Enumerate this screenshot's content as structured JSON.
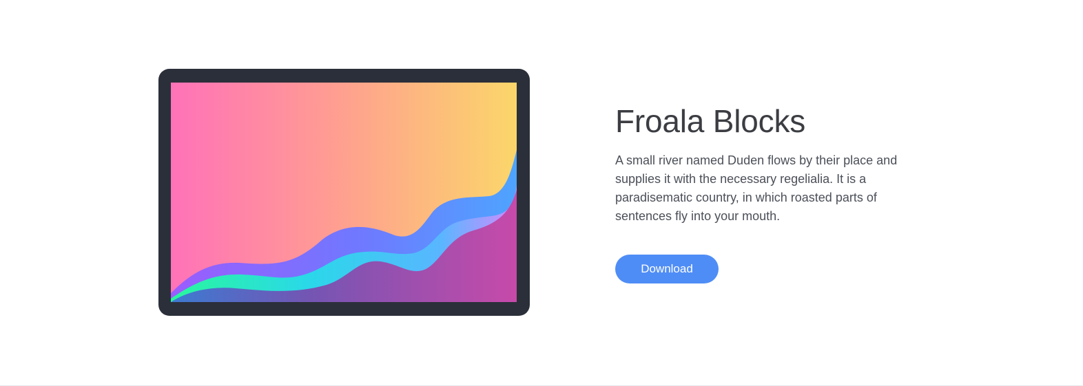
{
  "hero": {
    "title": "Froala Blocks",
    "description": "A small river named Duden flows by their place and supplies it with the necessary regelialia. It is a paradisematic country, in which roasted parts of sentences fly into your mouth.",
    "download_label": "Download"
  },
  "illustration": {
    "icon": "wave-illustration",
    "frame_color": "#2b2f3a",
    "colors": {
      "pink": "#ff72b8",
      "yellow": "#fbd66a",
      "purple": "#8e5cff",
      "blue": "#4e98ff",
      "cyan": "#2bd8e8",
      "green": "#2ef1a1",
      "violet": "#c54ba8",
      "button": "#4f8df6"
    }
  }
}
